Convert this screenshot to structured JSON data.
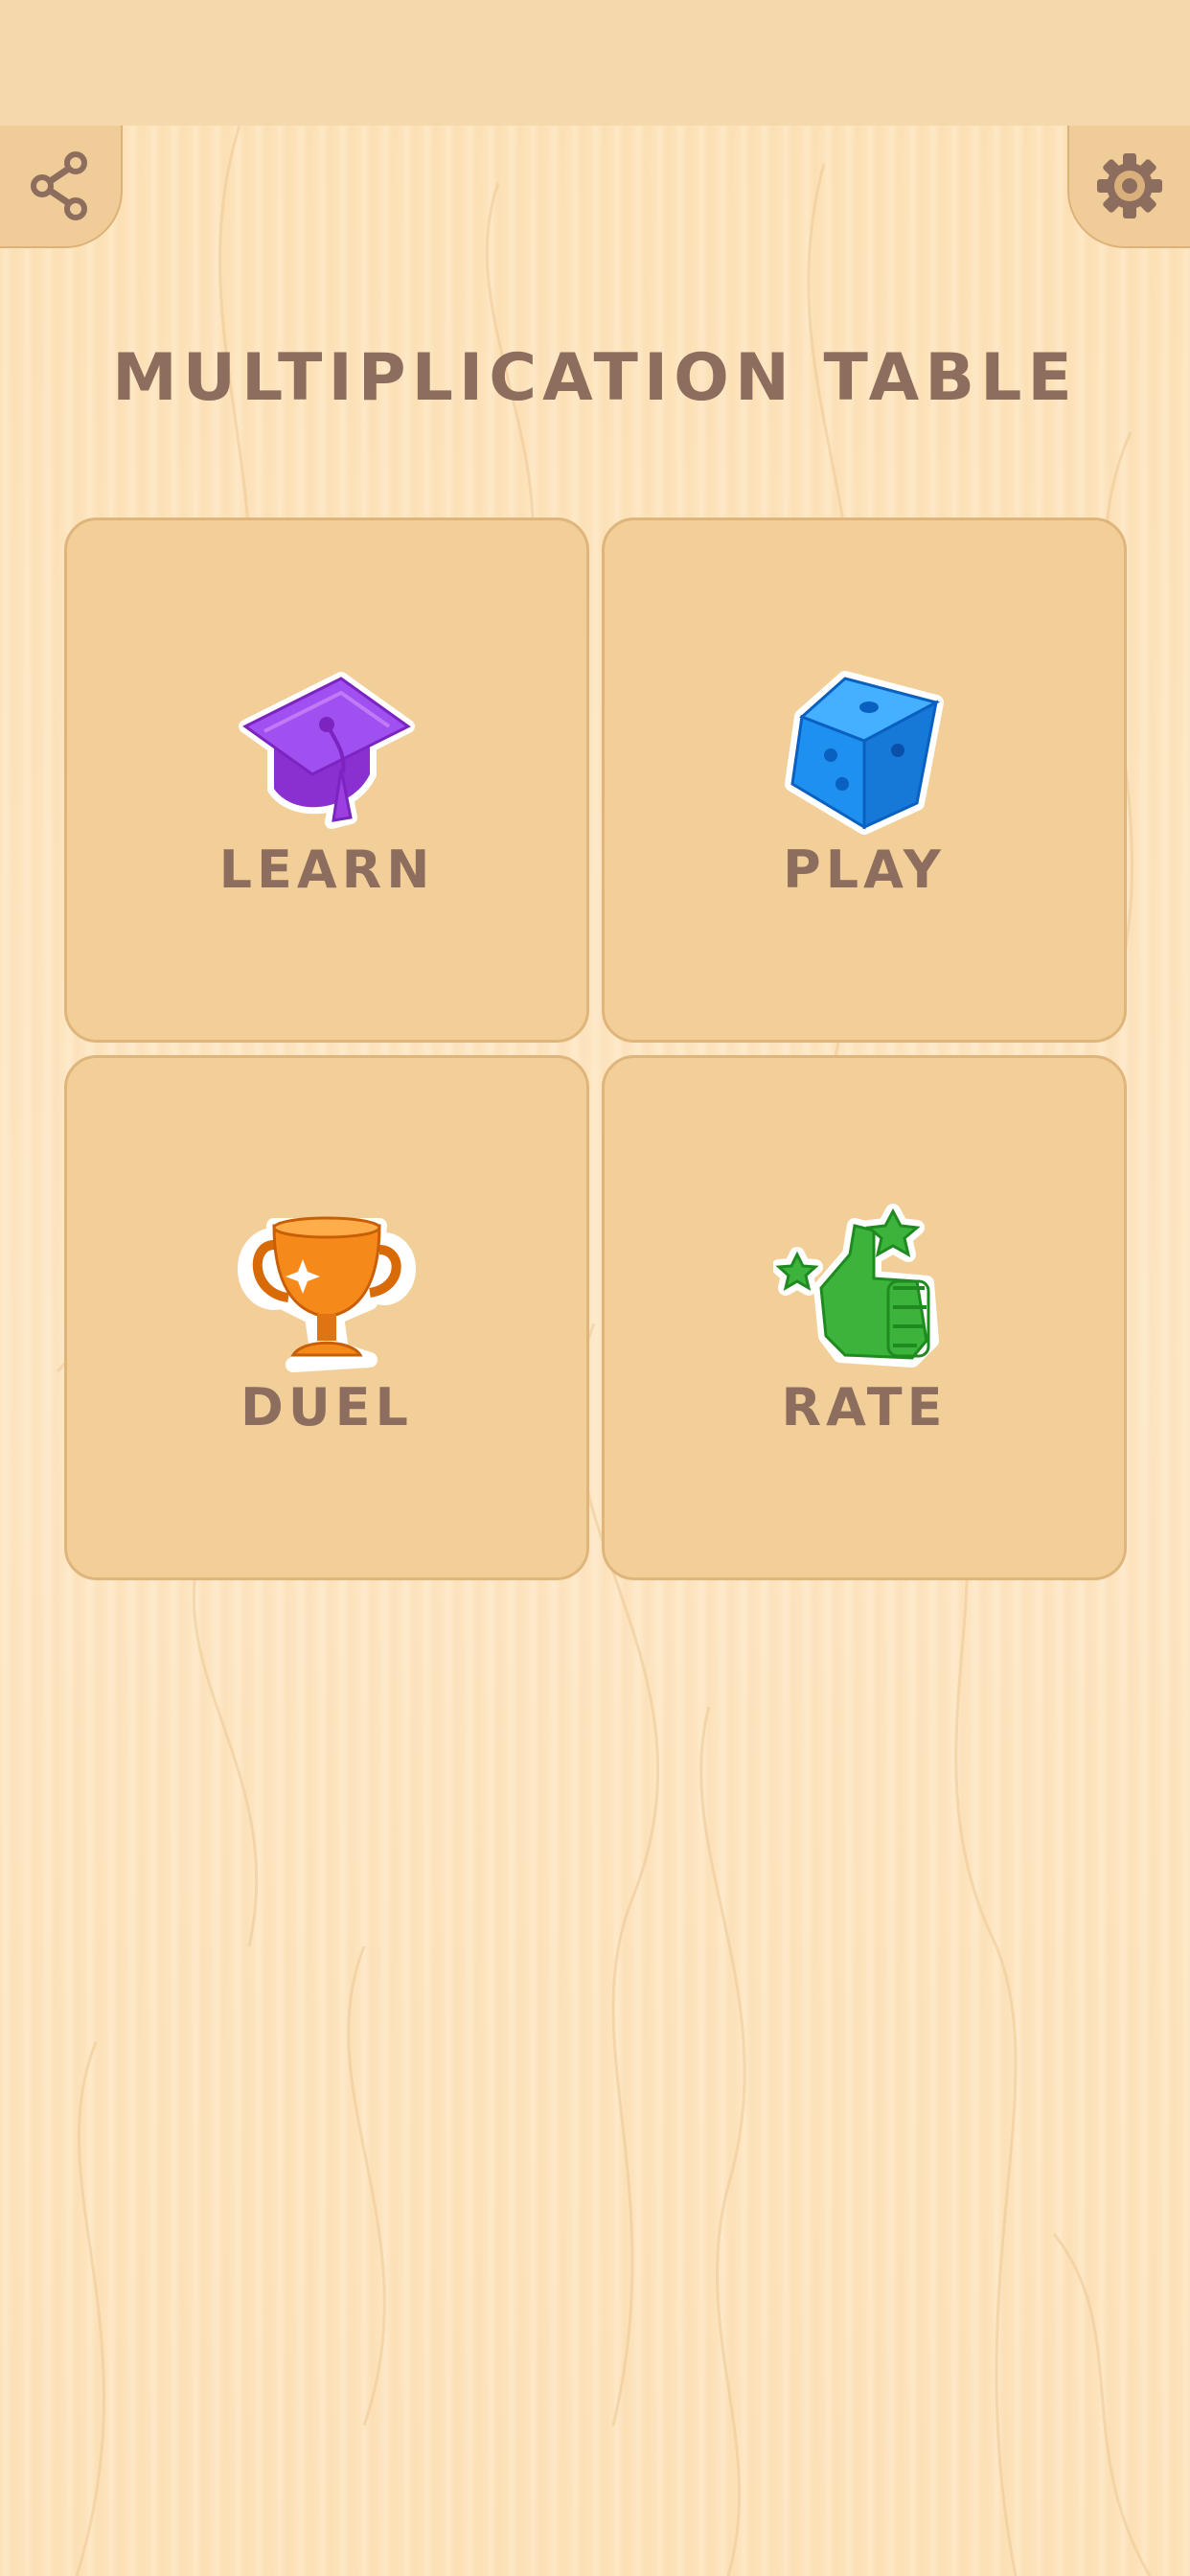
{
  "app": {
    "title": "MULTIPLICATION TABLE"
  },
  "toolbar": {
    "share_icon": "share-icon",
    "settings_icon": "gear-icon"
  },
  "menu": {
    "items": [
      {
        "label": "LEARN",
        "icon": "graduation-cap-icon",
        "color": "#9b3fe0"
      },
      {
        "label": "PLAY",
        "icon": "dice-icon",
        "color": "#1e90f0"
      },
      {
        "label": "DUEL",
        "icon": "trophy-icon",
        "color": "#f07d10"
      },
      {
        "label": "RATE",
        "icon": "thumbs-up-icon",
        "color": "#3cb43c"
      }
    ]
  },
  "colors": {
    "background": "#fde6c1",
    "tile": "#f2cf99",
    "text": "#8d6e5e"
  }
}
